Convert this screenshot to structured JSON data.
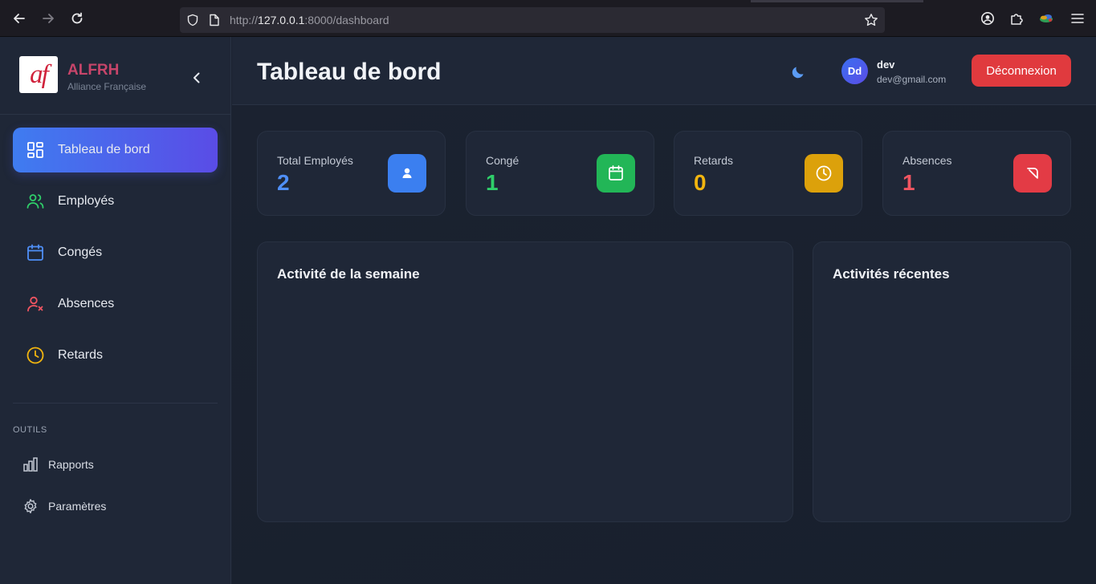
{
  "browser": {
    "url_scheme": "http://",
    "url_host": "127.0.0.1",
    "url_path": ":8000/dashboard"
  },
  "brand": {
    "logo_text": "af",
    "name": "ALFRH",
    "subtitle": "Alliance Française"
  },
  "sidebar": {
    "items": [
      {
        "label": "Tableau de bord",
        "icon": "dashboard-grid-icon",
        "active": true
      },
      {
        "label": "Employés",
        "icon": "users-icon"
      },
      {
        "label": "Congés",
        "icon": "calendar-icon"
      },
      {
        "label": "Absences",
        "icon": "user-x-icon"
      },
      {
        "label": "Retards",
        "icon": "clock-icon"
      }
    ],
    "section_title": "OUTILS",
    "tools": [
      {
        "label": "Rapports",
        "icon": "bar-chart-icon"
      },
      {
        "label": "Paramètres",
        "icon": "gear-icon"
      }
    ]
  },
  "header": {
    "title": "Tableau de bord",
    "avatar_initials": "Dd",
    "user_name": "dev",
    "user_email": "dev@gmail.com",
    "logout_label": "Déconnexion"
  },
  "stats": [
    {
      "label": "Total Employés",
      "value": "2",
      "color": "#4f8ff7",
      "icon": "user-icon",
      "icon_bg": "#3b7ff0"
    },
    {
      "label": "Congé",
      "value": "1",
      "color": "#2fcf6a",
      "icon": "calendar-icon",
      "icon_bg": "#22b657"
    },
    {
      "label": "Retards",
      "value": "0",
      "color": "#f2b50f",
      "icon": "clock-icon",
      "icon_bg": "#dca10b"
    },
    {
      "label": "Absences",
      "value": "1",
      "color": "#f05561",
      "icon": "ban-icon",
      "icon_bg": "#e33b45"
    }
  ],
  "panels": {
    "weekly_title": "Activité de la semaine",
    "recent_title": "Activités récentes"
  }
}
